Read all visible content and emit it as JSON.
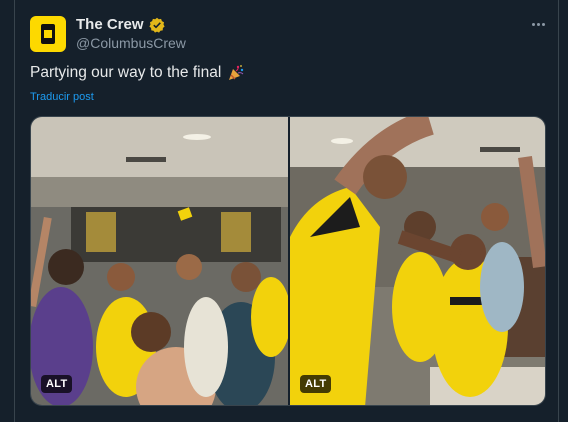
{
  "tweet": {
    "display_name": "The Crew",
    "handle": "@ColumbusCrew",
    "text": "Partying our way to the final",
    "translate_label": "Traducir post",
    "avatar_icon": "columbus-crew-logo",
    "verified_color": "#e2b719"
  },
  "media": {
    "photos": [
      {
        "alt_label": "ALT"
      },
      {
        "alt_label": "ALT"
      }
    ]
  },
  "colors": {
    "background": "#15202b",
    "link": "#1d9bf0",
    "jersey_yellow": "#f2d20c"
  }
}
